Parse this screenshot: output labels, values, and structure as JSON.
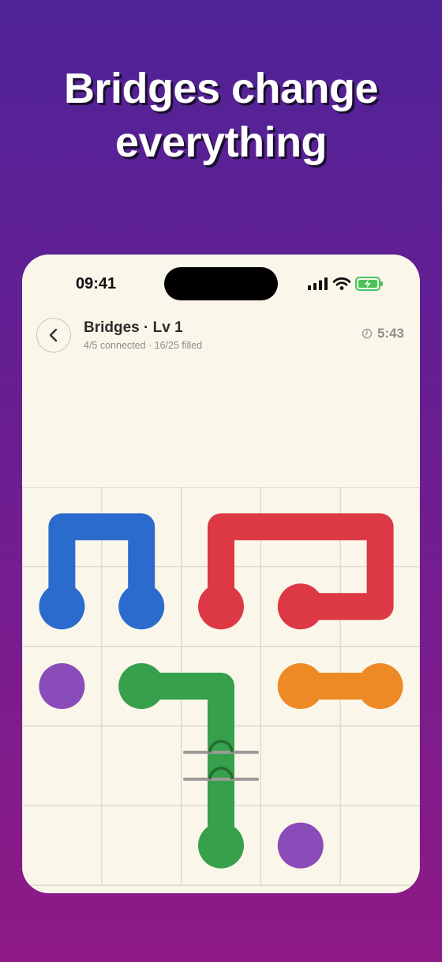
{
  "headline": {
    "line1": "Bridges change",
    "line2": "everything"
  },
  "status_bar": {
    "time": "09:41"
  },
  "header": {
    "title": "Bridges · Lv 1",
    "subtitle": "4/5 connected · 16/25 filled",
    "timer": "5:43"
  },
  "icons": {
    "back": "chevron-left-icon",
    "timer": "clock-icon",
    "signal": "cellular-signal-icon",
    "wifi": "wifi-icon",
    "battery": "battery-charging-icon"
  },
  "colors": {
    "blue": "#2c6bce",
    "red": "#dc3944",
    "purple": "#8a4cb8",
    "green": "#36a04c",
    "orange": "#ee8a25",
    "board_bg": "#fbf6ea",
    "grid": "#d6d3cc"
  },
  "puzzle": {
    "grid_size": 5,
    "endpoints": [
      {
        "color": "blue",
        "cell": [
          0,
          1
        ]
      },
      {
        "color": "blue",
        "cell": [
          1,
          1
        ]
      },
      {
        "color": "red",
        "cell": [
          2,
          1
        ]
      },
      {
        "color": "red",
        "cell": [
          3,
          1
        ]
      },
      {
        "color": "purple",
        "cell": [
          0,
          2
        ]
      },
      {
        "color": "purple",
        "cell": [
          3,
          4
        ]
      },
      {
        "color": "green",
        "cell": [
          1,
          2
        ]
      },
      {
        "color": "green",
        "cell": [
          2,
          4
        ]
      },
      {
        "color": "orange",
        "cell": [
          3,
          2
        ]
      },
      {
        "color": "orange",
        "cell": [
          4,
          2
        ]
      }
    ],
    "paths": [
      {
        "color": "blue",
        "cells": [
          [
            0,
            1
          ],
          [
            0,
            0
          ],
          [
            1,
            0
          ],
          [
            1,
            1
          ]
        ]
      },
      {
        "color": "red",
        "cells": [
          [
            2,
            1
          ],
          [
            2,
            0
          ],
          [
            3,
            0
          ],
          [
            4,
            0
          ],
          [
            4,
            1
          ],
          [
            3,
            1
          ]
        ]
      },
      {
        "color": "green",
        "cells": [
          [
            1,
            2
          ],
          [
            2,
            2
          ],
          [
            2,
            3
          ],
          [
            2,
            4
          ]
        ]
      },
      {
        "color": "orange",
        "cells": [
          [
            3,
            2
          ],
          [
            4,
            2
          ]
        ]
      }
    ],
    "bridge_cell": [
      2,
      3
    ]
  }
}
